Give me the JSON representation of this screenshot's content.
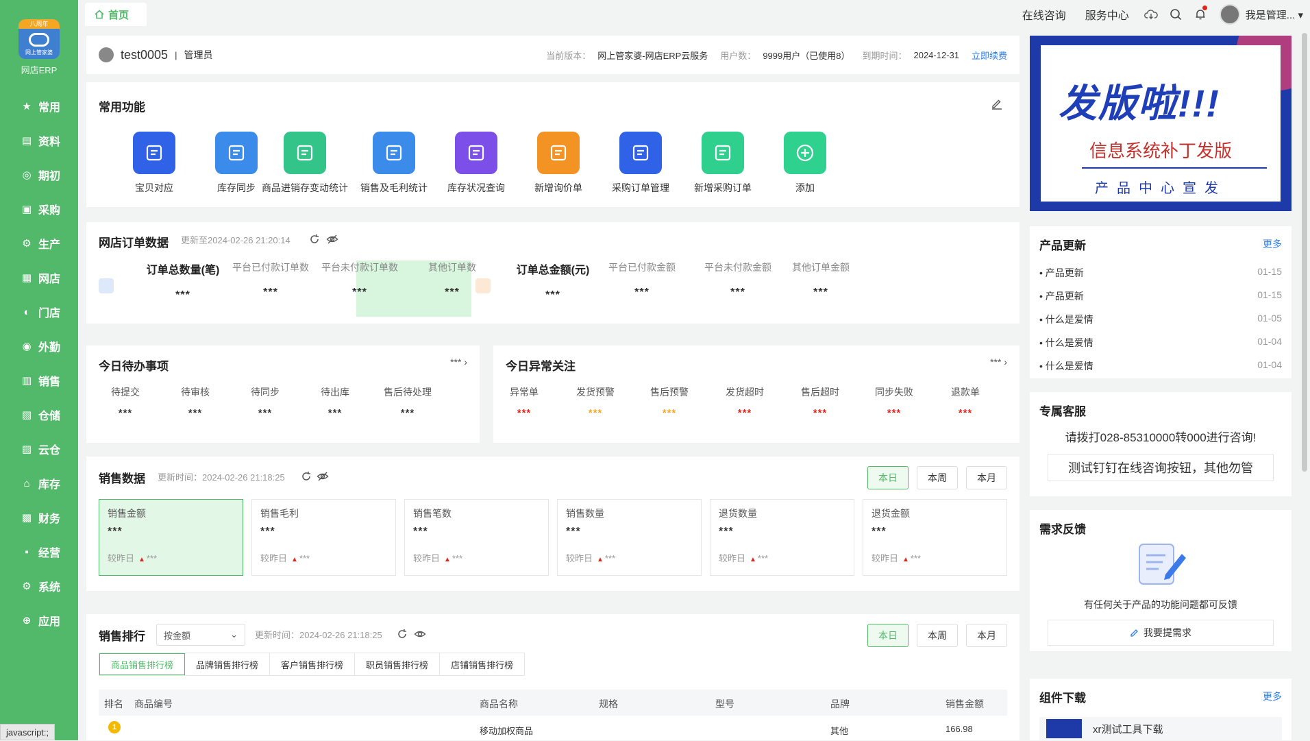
{
  "app": {
    "logo_top_text": "八周年",
    "logo_brand_text": "网上管家婆",
    "name": "网店ERP"
  },
  "nav": [
    {
      "label": "常用",
      "icon": "star-icon",
      "glyph": "★"
    },
    {
      "label": "资料",
      "icon": "document-icon",
      "glyph": "▤"
    },
    {
      "label": "期初",
      "icon": "target-icon",
      "glyph": "◎"
    },
    {
      "label": "采购",
      "icon": "cart-icon",
      "glyph": "▣"
    },
    {
      "label": "生产",
      "icon": "factory-icon",
      "glyph": "⚙"
    },
    {
      "label": "网店",
      "icon": "shop-icon",
      "glyph": "▦"
    },
    {
      "label": "门店",
      "icon": "store-icon",
      "glyph": "◐"
    },
    {
      "label": "外勤",
      "icon": "field-icon",
      "glyph": "◉"
    },
    {
      "label": "销售",
      "icon": "chart-icon",
      "glyph": "▥"
    },
    {
      "label": "仓储",
      "icon": "warehouse-icon",
      "glyph": "▧"
    },
    {
      "label": "云仓",
      "icon": "cloud-warehouse-icon",
      "glyph": "▨"
    },
    {
      "label": "库存",
      "icon": "inventory-icon",
      "glyph": "⌂"
    },
    {
      "label": "财务",
      "icon": "finance-icon",
      "glyph": "▩"
    },
    {
      "label": "经营",
      "icon": "business-icon",
      "glyph": "▪"
    },
    {
      "label": "系统",
      "icon": "system-icon",
      "glyph": "⚙"
    },
    {
      "label": "应用",
      "icon": "apps-icon",
      "glyph": "⊕"
    }
  ],
  "status_bar": "javascript:;",
  "topbar": {
    "home_tab": "首页",
    "online_consult": "在线咨询",
    "service_center": "服务中心",
    "user_name": "我是管理..."
  },
  "user_info": {
    "name": "test0005",
    "separator": "|",
    "role": "管理员",
    "version_label": "当前版本：",
    "version": "网上管家婆-网店ERP云服务",
    "users_label": "用户数：",
    "users": "9999用户（已使用8）",
    "expire_label": "到期时间：",
    "expire": "2024-12-31",
    "renew": "立即续费"
  },
  "common": {
    "title": "常用功能",
    "items": [
      {
        "label": "宝贝对应",
        "color": "#2f62e6"
      },
      {
        "label": "库存同步",
        "color": "#3b8beb"
      },
      {
        "label": "商品进销存变动统计",
        "color": "#33c48a"
      },
      {
        "label": "销售及毛利统计",
        "color": "#3b8beb"
      },
      {
        "label": "库存状况查询",
        "color": "#7b4fe8"
      },
      {
        "label": "新增询价单",
        "color": "#f39324"
      },
      {
        "label": "采购订单管理",
        "color": "#2f62e6"
      },
      {
        "label": "新增采购订单",
        "color": "#2fcf8e"
      },
      {
        "label": "添加",
        "color": "#2fd18f"
      }
    ]
  },
  "banner": {
    "headline": "发版啦!!!",
    "subtitle": "信息系统补丁发版",
    "footer": "产品中心宣发"
  },
  "orders": {
    "title": "网店订单数据",
    "updated": "更新至2024-02-26 21:20:14",
    "stats": [
      {
        "label": "订单总数量(笔)",
        "value": "***"
      },
      {
        "label": "平台已付款订单数",
        "value": "***"
      },
      {
        "label": "平台未付款订单数",
        "value": "***"
      },
      {
        "label": "其他订单数",
        "value": "***"
      },
      {
        "label": "订单总金额(元)",
        "value": "***"
      },
      {
        "label": "平台已付款金额",
        "value": "***"
      },
      {
        "label": "平台未付款金额",
        "value": "***"
      },
      {
        "label": "其他订单金额",
        "value": "***"
      }
    ]
  },
  "todo": {
    "title": "今日待办事项",
    "more": "***",
    "items": [
      {
        "label": "待提交",
        "value": "***"
      },
      {
        "label": "待审核",
        "value": "***"
      },
      {
        "label": "待同步",
        "value": "***"
      },
      {
        "label": "待出库",
        "value": "***"
      },
      {
        "label": "售后待处理",
        "value": "***"
      }
    ]
  },
  "abnormal": {
    "title": "今日异常关注",
    "more": "***",
    "items": [
      {
        "label": "异常单",
        "value": "***",
        "color": "#e2231a"
      },
      {
        "label": "发货预警",
        "value": "***",
        "color": "#f5a623"
      },
      {
        "label": "售后预警",
        "value": "***",
        "color": "#f5a623"
      },
      {
        "label": "发货超时",
        "value": "***",
        "color": "#e2231a"
      },
      {
        "label": "售后超时",
        "value": "***",
        "color": "#e2231a"
      },
      {
        "label": "同步失败",
        "value": "***",
        "color": "#e2231a"
      },
      {
        "label": "退款单",
        "value": "***",
        "color": "#e2231a"
      }
    ]
  },
  "sales": {
    "title": "销售数据",
    "updated": "更新时间：2024-02-26 21:18:25",
    "periods": [
      "本日",
      "本周",
      "本月"
    ],
    "cards": [
      {
        "label": "销售金额",
        "value": "***",
        "cmp_label": "较昨日",
        "cmp_value": "***"
      },
      {
        "label": "销售毛利",
        "value": "***",
        "cmp_label": "较昨日",
        "cmp_value": "***"
      },
      {
        "label": "销售笔数",
        "value": "***",
        "cmp_label": "较昨日",
        "cmp_value": "***"
      },
      {
        "label": "销售数量",
        "value": "***",
        "cmp_label": "较昨日",
        "cmp_value": "***"
      },
      {
        "label": "退货数量",
        "value": "***",
        "cmp_label": "较昨日",
        "cmp_value": "***"
      },
      {
        "label": "退货金额",
        "value": "***",
        "cmp_label": "较昨日",
        "cmp_value": "***"
      }
    ]
  },
  "ranking": {
    "title": "销售排行",
    "select_value": "按金额",
    "updated": "更新时间：2024-02-26 21:18:25",
    "periods": [
      "本日",
      "本周",
      "本月"
    ],
    "tabs": [
      "商品销售排行榜",
      "品牌销售排行榜",
      "客户销售排行榜",
      "职员销售排行榜",
      "店铺销售排行榜"
    ],
    "columns": [
      "排名",
      "商品编号",
      "商品名称",
      "规格",
      "型号",
      "品牌",
      "销售金额"
    ],
    "rows": [
      {
        "rank": "1",
        "code": "",
        "name": "移动加权商品",
        "spec": "",
        "model": "",
        "brand": "其他",
        "amount": "166.98"
      }
    ]
  },
  "updates": {
    "title": "产品更新",
    "more": "更多",
    "items": [
      {
        "title": "• 产品更新",
        "date": "01-15"
      },
      {
        "title": "• 产品更新",
        "date": "01-15"
      },
      {
        "title": "• 什么是爱情",
        "date": "01-05"
      },
      {
        "title": "• 什么是爱情",
        "date": "01-04"
      },
      {
        "title": "• 什么是爱情",
        "date": "01-04"
      }
    ]
  },
  "service": {
    "title": "专属客服",
    "text": "请拨打028-85310000转000进行咨询!",
    "button": "测试钉钉在线咨询按钮，其他勿管"
  },
  "feedback": {
    "title": "需求反馈",
    "text": "有任何关于产品的功能问题都可反馈",
    "button": "我要提需求"
  },
  "downloads": {
    "title": "组件下载",
    "more": "更多",
    "item": "xr测试工具下载"
  }
}
